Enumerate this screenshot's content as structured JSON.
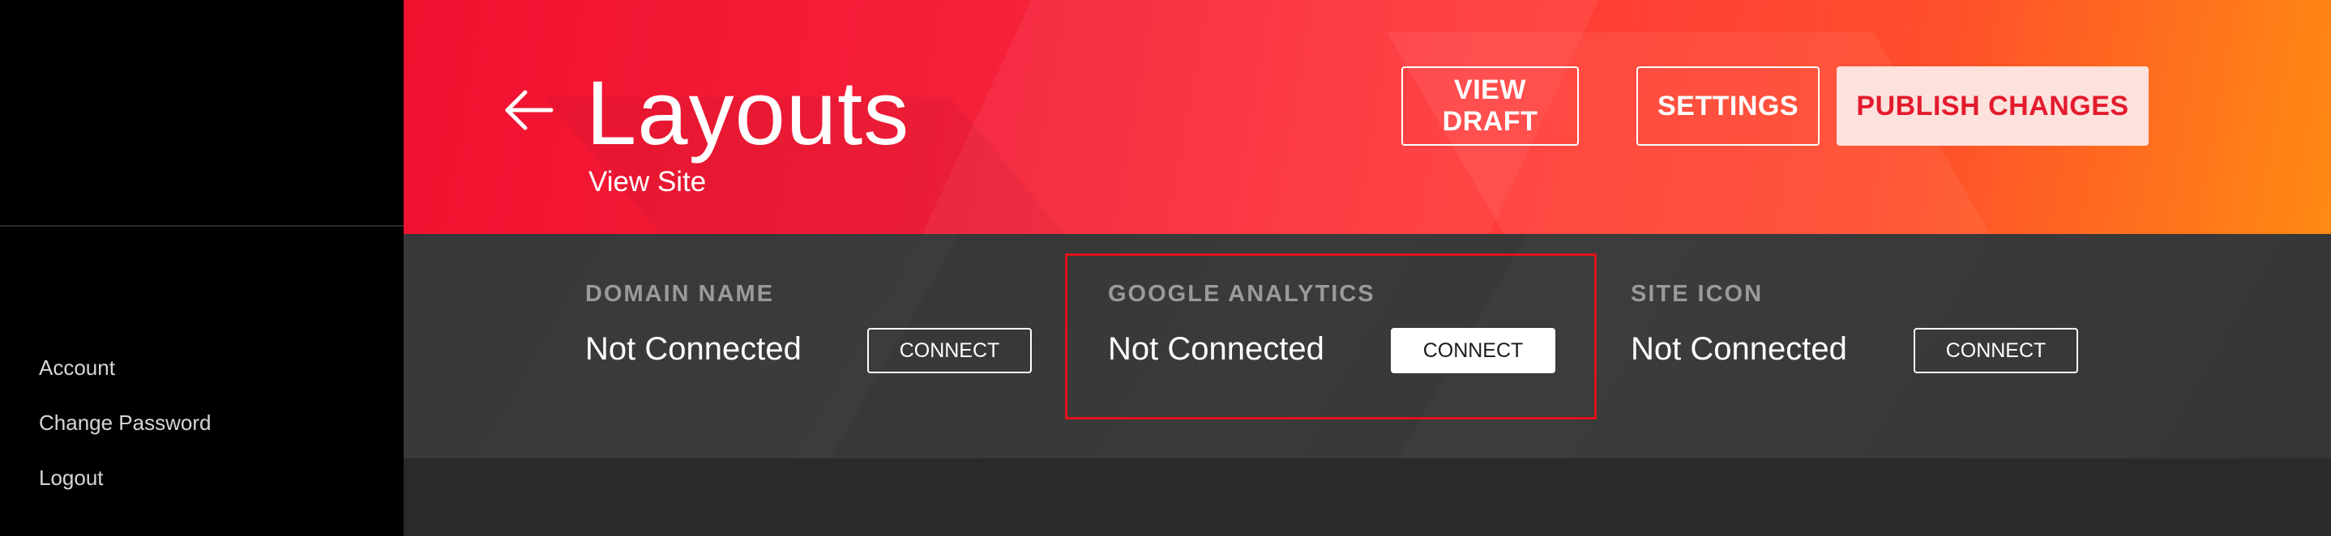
{
  "sidebar": {
    "items": [
      {
        "label": "Account"
      },
      {
        "label": "Change Password"
      },
      {
        "label": "Logout"
      }
    ]
  },
  "header": {
    "back_icon": "arrow-left-icon",
    "title": "Layouts",
    "view_site_label": "View Site",
    "buttons": {
      "view_draft": "VIEW DRAFT",
      "settings": "SETTINGS",
      "publish": "PUBLISH CHANGES"
    }
  },
  "integrations": [
    {
      "label": "DOMAIN NAME",
      "status": "Not Connected",
      "button": "CONNECT"
    },
    {
      "label": "GOOGLE ANALYTICS",
      "status": "Not Connected",
      "button": "CONNECT"
    },
    {
      "label": "SITE ICON",
      "status": "Not Connected",
      "button": "CONNECT"
    }
  ],
  "colors": {
    "accent": "#f0112f",
    "accent_end": "#ff8a12",
    "publish_text": "#e31b2d",
    "highlight": "#e0121a"
  }
}
